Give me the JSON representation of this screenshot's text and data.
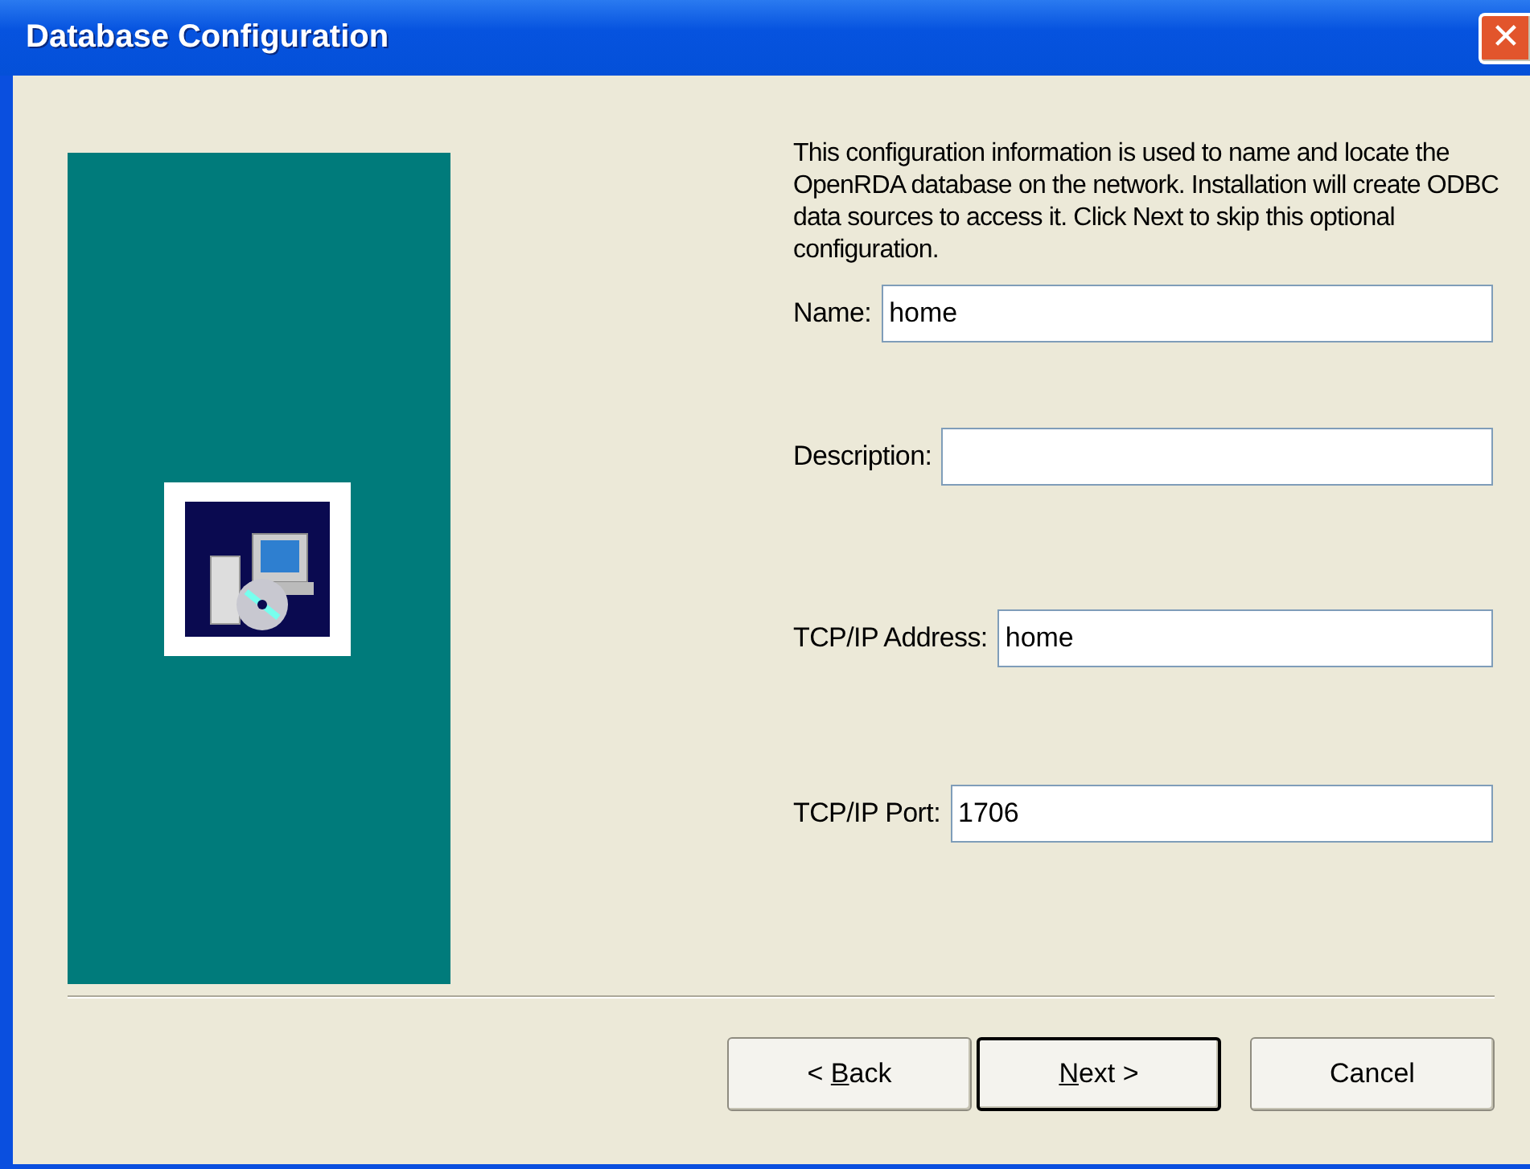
{
  "window": {
    "title": "Database Configuration",
    "close": "✕"
  },
  "description": "This configuration information is used to name and locate the OpenRDA database on the network. Installation will create ODBC data sources to access it. Click Next to skip this optional configuration.",
  "fields": [
    {
      "label": "Name:",
      "value": "home"
    },
    {
      "label": "Description:"
    },
    {
      "label": "TCP/IP Address:",
      "value": "home"
    },
    {
      "label": "TCP/IP Port:",
      "value": "1706"
    }
  ],
  "buttons": [
    {
      "pre": "< ",
      "key": "B",
      "post": "ack",
      "default": false
    },
    {
      "key": "N",
      "post": "ext >",
      "default": true
    },
    {
      "pre": "Cancel",
      "default": false
    }
  ]
}
